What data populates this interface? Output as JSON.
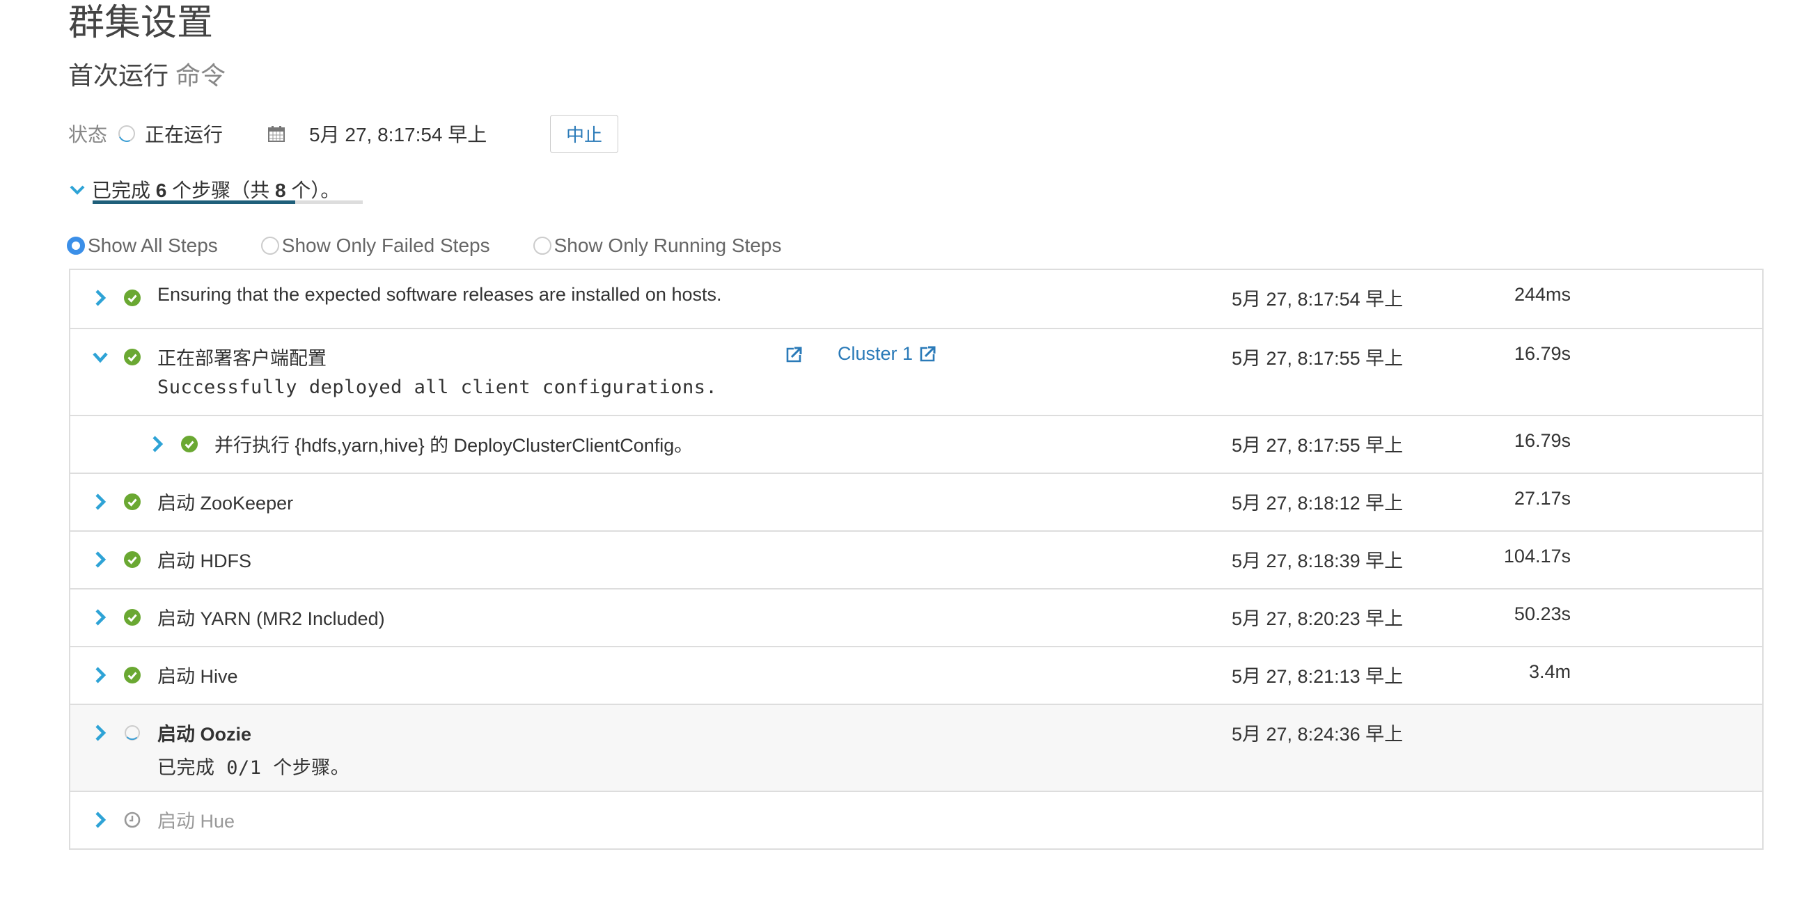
{
  "page": {
    "title": "群集设置",
    "subtitle_main": "首次运行",
    "subtitle_muted": "命令"
  },
  "status": {
    "label": "状态",
    "value": "正在运行",
    "start_time": "5月 27, 8:17:54 早上",
    "stop_button": "中止"
  },
  "summary": {
    "prefix": "已完成",
    "completed": "6",
    "middle": "个步骤（共",
    "total": "8",
    "suffix": "个）。",
    "progress_fraction": 0.75
  },
  "filters": [
    {
      "label": "Show All Steps",
      "checked": true
    },
    {
      "label": "Show Only Failed Steps",
      "checked": false
    },
    {
      "label": "Show Only Running Steps",
      "checked": false
    }
  ],
  "colors": {
    "accent_blue": "#2a7ab8",
    "chevron_blue": "#2ea3d6",
    "success_green": "#6aa832",
    "progress_fill": "#1f5f7a",
    "radio_checked": "#3b8fe8"
  },
  "steps": [
    {
      "label": "Ensuring that the expected software releases are installed on hosts.",
      "status": "success",
      "expanded": false,
      "date": "5月 27, 8:17:54 早上",
      "duration": "244ms"
    },
    {
      "label": "正在部署客户端配置",
      "status": "success",
      "expanded": true,
      "detail": "Successfully deployed all client configurations.",
      "link": "Cluster 1",
      "date": "5月 27, 8:17:55 早上",
      "duration": "16.79s"
    },
    {
      "label": "并行执行 {hdfs,yarn,hive} 的 DeployClusterClientConfig。",
      "status": "success",
      "expanded": false,
      "child": true,
      "date": "5月 27, 8:17:55 早上",
      "duration": "16.79s"
    },
    {
      "label": "启动 ZooKeeper",
      "status": "success",
      "expanded": false,
      "date": "5月 27, 8:18:12 早上",
      "duration": "27.17s"
    },
    {
      "label": "启动 HDFS",
      "status": "success",
      "expanded": false,
      "date": "5月 27, 8:18:39 早上",
      "duration": "104.17s"
    },
    {
      "label": "启动 YARN (MR2 Included)",
      "status": "success",
      "expanded": false,
      "date": "5月 27, 8:20:23 早上",
      "duration": "50.23s"
    },
    {
      "label": "启动 Hive",
      "status": "success",
      "expanded": false,
      "date": "5月 27, 8:21:13 早上",
      "duration": "3.4m"
    },
    {
      "label": "启动 Oozie",
      "status": "running",
      "expanded": false,
      "detail": "已完成 0/1 个步骤。",
      "date": "5月 27, 8:24:36 早上",
      "duration": ""
    },
    {
      "label": "启动 Hue",
      "status": "pending",
      "expanded": false,
      "date": "",
      "duration": ""
    }
  ]
}
